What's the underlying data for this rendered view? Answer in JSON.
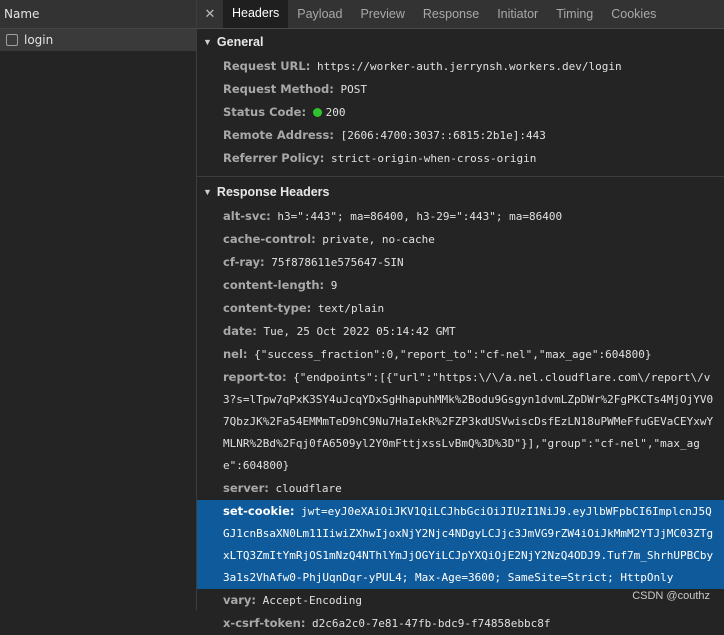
{
  "left_panel": {
    "header": "Name",
    "items": [
      {
        "label": "login"
      }
    ]
  },
  "tabs": [
    "Headers",
    "Payload",
    "Preview",
    "Response",
    "Initiator",
    "Timing",
    "Cookies"
  ],
  "general": {
    "title": "General",
    "rows": [
      {
        "key": "Request URL:",
        "value": "https://worker-auth.jerrynsh.workers.dev/login"
      },
      {
        "key": "Request Method:",
        "value": "POST"
      },
      {
        "key": "Status Code:",
        "value": "200"
      },
      {
        "key": "Remote Address:",
        "value": "[2606:4700:3037::6815:2b1e]:443"
      },
      {
        "key": "Referrer Policy:",
        "value": "strict-origin-when-cross-origin"
      }
    ]
  },
  "response_headers": {
    "title": "Response Headers",
    "rows": [
      {
        "key": "alt-svc:",
        "value": "h3=\":443\"; ma=86400, h3-29=\":443\"; ma=86400"
      },
      {
        "key": "cache-control:",
        "value": "private, no-cache"
      },
      {
        "key": "cf-ray:",
        "value": "75f878611e575647-SIN"
      },
      {
        "key": "content-length:",
        "value": "9"
      },
      {
        "key": "content-type:",
        "value": "text/plain"
      },
      {
        "key": "date:",
        "value": "Tue, 25 Oct 2022 05:14:42 GMT"
      },
      {
        "key": "nel:",
        "value": "{\"success_fraction\":0,\"report_to\":\"cf-nel\",\"max_age\":604800}"
      },
      {
        "key": "report-to:",
        "value": "{\"endpoints\":[{\"url\":\"https:\\/\\/a.nel.cloudflare.com\\/report\\/v3?s=lTpw7qPxK3SY4uJcqYDxSgHhapuhMMk%2Bodu9Gsgyn1dvmLZpDWr%2FgPKCTs4MjOjYV07QbzJK%2Fa54EMMmTeD9hC9Nu7HaIekR%2FZP3kdUSVwiscDsfEzLN18uPWMeFfuGEVaCEYxwYMLNR%2Bd%2Fqj0fA6509yl2Y0mFttjxssLvBmQ%3D%3D\"}],\"group\":\"cf-nel\",\"max_age\":604800}"
      },
      {
        "key": "server:",
        "value": "cloudflare"
      },
      {
        "key": "set-cookie:",
        "value": "jwt=eyJ0eXAiOiJKV1QiLCJhbGciOiJIUzI1NiJ9.eyJlbWFpbCI6ImplcnJ5QGJ1cnBsaXN0Lm11IiwiZXhwIjoxNjY2Njc4NDgyLCJjc3JmVG9rZW4iOiJkMmM2YTJjMC03ZTgxLTQ3ZmItYmRjOS1mNzQ4NThlYmJjOGYiLCJpYXQiOjE2NjY2NzQ4ODJ9.Tuf7m_ShrhUPBCby3a1s2VhAfw0-PhjUqnDqr-yPUL4; Max-Age=3600; SameSite=Strict; HttpOnly",
        "selected": true
      },
      {
        "key": "vary:",
        "value": "Accept-Encoding"
      },
      {
        "key": "x-csrf-token:",
        "value": "d2c6a2c0-7e81-47fb-bdc9-f74858ebbc8f"
      }
    ]
  },
  "watermark": "CSDN @couthz"
}
